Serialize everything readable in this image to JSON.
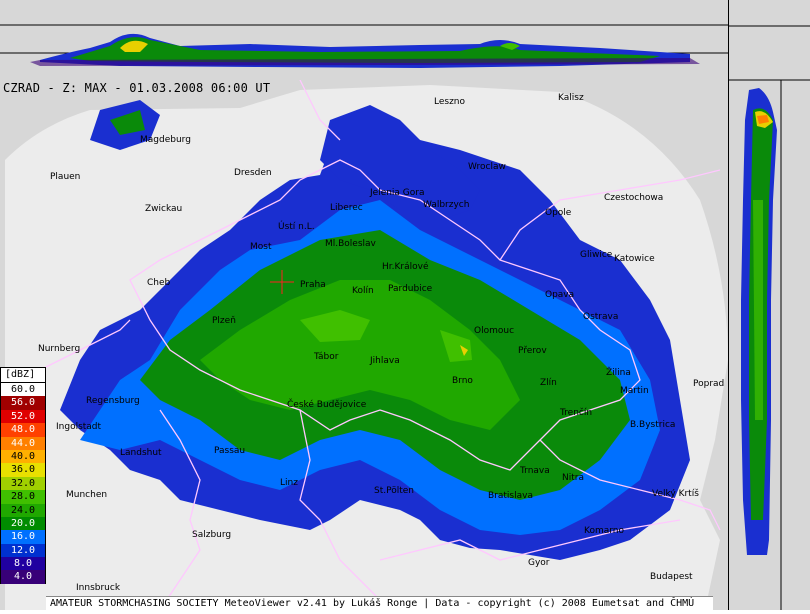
{
  "title": "CZRAD - Z: MAX - 01.03.2008 06:00 UT",
  "footer": "AMATEUR STORMCHASING SOCIETY MeteoViewer v2.41 by Lukáš Ronge | Data - copyright (c) 2008 Eumetsat and ČHMÚ",
  "legend": {
    "unit": "[dBZ]",
    "levels": [
      {
        "label": "60.0",
        "color": "#ffffff",
        "text": "#000000"
      },
      {
        "label": "56.0",
        "color": "#a00000",
        "text": "#ffffff"
      },
      {
        "label": "52.0",
        "color": "#e00000",
        "text": "#ffffff"
      },
      {
        "label": "48.0",
        "color": "#ff4000",
        "text": "#ffffff"
      },
      {
        "label": "44.0",
        "color": "#ff8000",
        "text": "#ffffff"
      },
      {
        "label": "40.0",
        "color": "#ffb000",
        "text": "#000000"
      },
      {
        "label": "36.0",
        "color": "#e8e000",
        "text": "#000000"
      },
      {
        "label": "32.0",
        "color": "#a0d000",
        "text": "#000000"
      },
      {
        "label": "28.0",
        "color": "#40c000",
        "text": "#000000"
      },
      {
        "label": "24.0",
        "color": "#20a800",
        "text": "#000000"
      },
      {
        "label": "20.0",
        "color": "#008c00",
        "text": "#ffffff"
      },
      {
        "label": "16.0",
        "color": "#0070ff",
        "text": "#ffffff"
      },
      {
        "label": "12.0",
        "color": "#0030d0",
        "text": "#ffffff"
      },
      {
        "label": "8.0",
        "color": "#2000a0",
        "text": "#ffffff"
      },
      {
        "label": "4.0",
        "color": "#380078",
        "text": "#ffffff"
      }
    ]
  },
  "cities": [
    "Leszno",
    "Kalisz",
    "Wroclaw",
    "Magdeburg",
    "Dresden",
    "Jelenia Gora",
    "Walbrzych",
    "Czestochowa",
    "Zwickau",
    "Liberec",
    "Ústí n.L.",
    "Opole",
    "Ml.Boleslav",
    "Most",
    "Gliwice",
    "Katowice",
    "Hr.Králové",
    "Cheb",
    "Praha",
    "Kolín",
    "Pardubice",
    "Opava",
    "Ostrava",
    "Plzeň",
    "Olomouc",
    "Nurnberg",
    "Přerov",
    "Tábor",
    "Jihlava",
    "Zlín",
    "Brno",
    "Žilina",
    "Martin",
    "Poprad",
    "Regensburg",
    "České Budějovice",
    "Ingolstadt",
    "Trenčín",
    "B.Bystrica",
    "Landshut",
    "Passau",
    "Trnava",
    "Linz",
    "Nitra",
    "Munchen",
    "Bratislava",
    "Velký Krtíš",
    "St.Pölten",
    "Komarno",
    "Salzburg",
    "Gyor",
    "Budapest",
    "Innsbruck",
    "Plauen"
  ]
}
